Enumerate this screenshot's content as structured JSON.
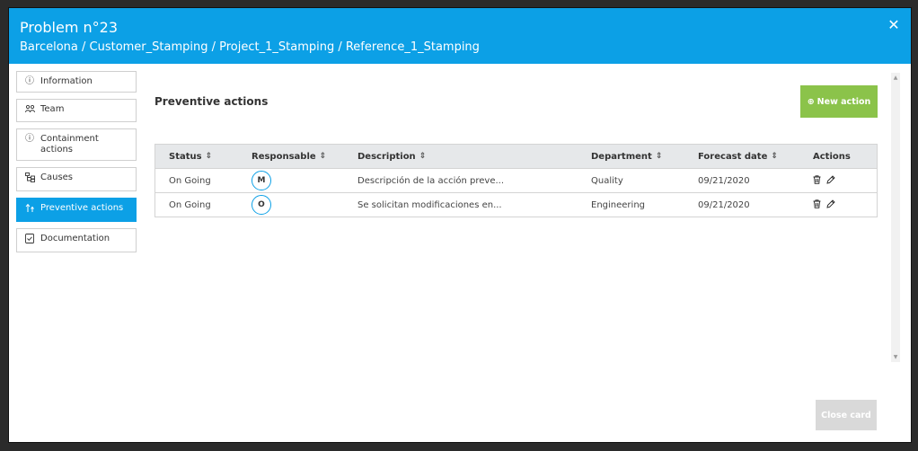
{
  "header": {
    "title": "Problem n°23",
    "breadcrumb": "Barcelona / Customer_Stamping / Project_1_Stamping / Reference_1_Stamping",
    "close_glyph": "✕"
  },
  "sidebar": {
    "items": [
      {
        "label": "Information",
        "icon": "info-icon"
      },
      {
        "label": "Team",
        "icon": "team-icon"
      },
      {
        "label": "Containment actions",
        "icon": "info-icon"
      },
      {
        "label": "Causes",
        "icon": "causes-icon"
      },
      {
        "label": "Preventive actions",
        "icon": "preventive-icon",
        "active": true
      },
      {
        "label": "Documentation",
        "icon": "document-icon"
      }
    ]
  },
  "main": {
    "section_title": "Preventive actions",
    "new_action_label": "New action",
    "table": {
      "headers": [
        "Status",
        "Responsable",
        "Description",
        "Department",
        "Forecast date",
        "Actions"
      ],
      "rows": [
        {
          "status": "On Going",
          "responsable": "M",
          "description": "Descripción de la acción preve...",
          "department": "Quality",
          "forecast_date": "09/21/2020"
        },
        {
          "status": "On Going",
          "responsable": "O",
          "description": "Se solicitan modificaciones en...",
          "department": "Engineering",
          "forecast_date": "09/21/2020"
        }
      ]
    }
  },
  "footer": {
    "close_card_label": "Close card"
  },
  "colors": {
    "accent": "#0ca0e6",
    "new_action": "#8bc34a",
    "disabled": "#d9d9d9"
  }
}
